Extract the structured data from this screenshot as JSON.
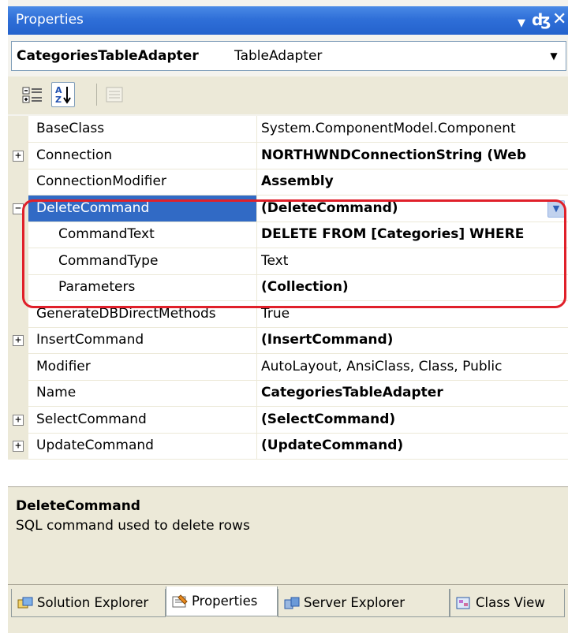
{
  "window": {
    "title": "Properties"
  },
  "object_selector": {
    "name": "CategoriesTableAdapter",
    "type": "TableAdapter"
  },
  "toolbar": {
    "categorized_icon": "categorized-icon",
    "alphabetical_icon": "alphabetical-icon",
    "property_pages_icon": "property-pages-icon"
  },
  "properties": [
    {
      "name": "BaseClass",
      "value": "System.ComponentModel.Component",
      "bold": false,
      "expander": null
    },
    {
      "name": "Connection",
      "value": "NORTHWNDConnectionString (Web",
      "bold": true,
      "expander": "+"
    },
    {
      "name": "ConnectionModifier",
      "value": "Assembly",
      "bold": true,
      "expander": null
    },
    {
      "name": "DeleteCommand",
      "value": "(DeleteCommand)",
      "bold": true,
      "expander": "−",
      "selected": true
    },
    {
      "name": "CommandText",
      "value": "DELETE FROM [Categories] WHERE",
      "bold": true,
      "child": true
    },
    {
      "name": "CommandType",
      "value": "Text",
      "bold": false,
      "child": true
    },
    {
      "name": "Parameters",
      "value": "(Collection)",
      "bold": true,
      "child": true
    },
    {
      "name": "GenerateDBDirectMethods",
      "value": "True",
      "bold": false,
      "expander": null
    },
    {
      "name": "InsertCommand",
      "value": "(InsertCommand)",
      "bold": true,
      "expander": "+"
    },
    {
      "name": "Modifier",
      "value": "AutoLayout, AnsiClass, Class, Public",
      "bold": false,
      "expander": null
    },
    {
      "name": "Name",
      "value": "CategoriesTableAdapter",
      "bold": true,
      "expander": null
    },
    {
      "name": "SelectCommand",
      "value": "(SelectCommand)",
      "bold": true,
      "expander": "+"
    },
    {
      "name": "UpdateCommand",
      "value": "(UpdateCommand)",
      "bold": true,
      "expander": "+"
    }
  ],
  "description": {
    "title": "DeleteCommand",
    "text": "SQL command used to delete rows"
  },
  "tabs": [
    {
      "label": "Solution Explorer",
      "icon": "solution-explorer-icon"
    },
    {
      "label": "Properties",
      "icon": "properties-icon",
      "active": true
    },
    {
      "label": "Server Explorer",
      "icon": "server-explorer-icon"
    },
    {
      "label": "Class View",
      "icon": "class-view-icon"
    }
  ],
  "colors": {
    "titlebar": "#2f6fd8",
    "selection": "#316ac5",
    "highlight_outline": "#e0202a"
  }
}
